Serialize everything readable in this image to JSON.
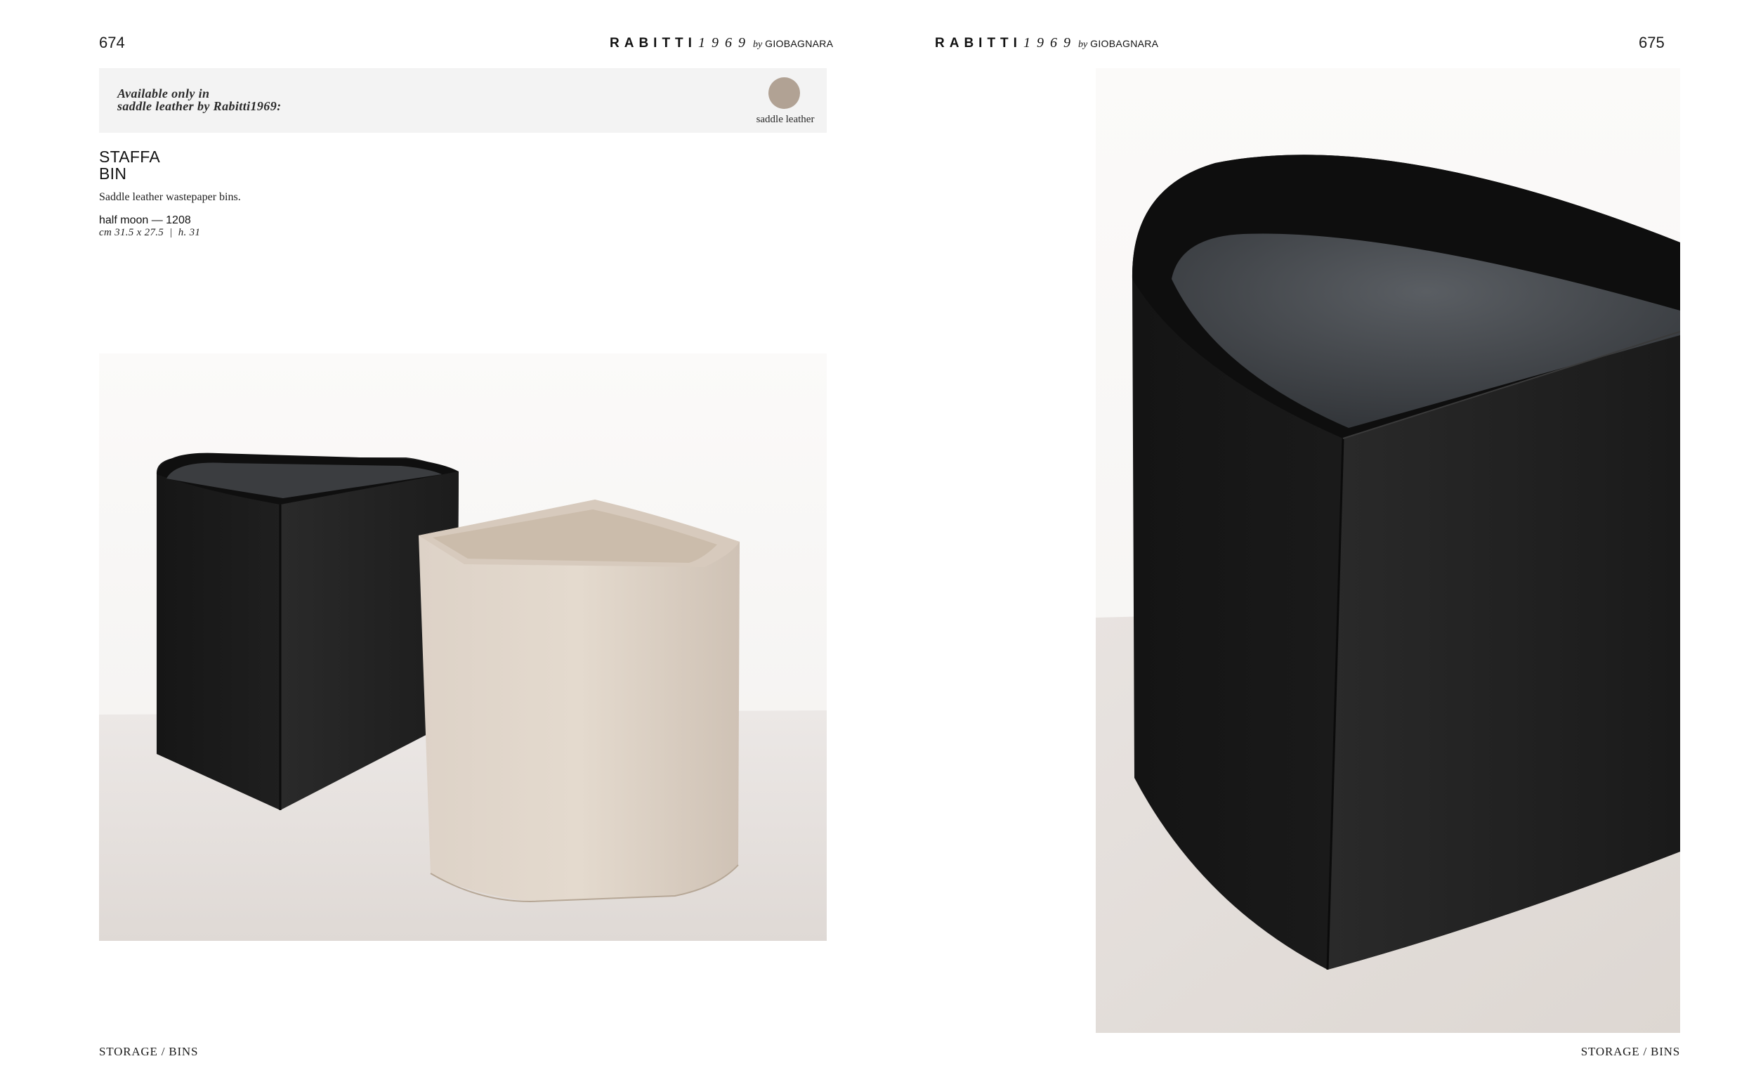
{
  "left_page": {
    "page_number": "674",
    "brand": {
      "word": "RABITTI",
      "year": "1969",
      "by": "by",
      "maker": "GIOBAGNARA"
    },
    "availability": {
      "line1": "Available only in",
      "line2": "saddle leather by Rabitti1969:",
      "swatch_label": "saddle leather",
      "swatch_color": "#b1a294"
    },
    "product": {
      "name_line1": "STAFFA",
      "name_line2": "BIN",
      "description": "Saddle leather wastepaper bins.",
      "variant": "half moon — 1208",
      "dimensions": "cm 31.5 x 27.5  |  h. 31"
    },
    "footer": "STORAGE / BINS"
  },
  "right_page": {
    "page_number": "675",
    "brand": {
      "word": "RABITTI",
      "year": "1969",
      "by": "by",
      "maker": "GIOBAGNARA"
    },
    "footer": "STORAGE / BINS"
  },
  "colors": {
    "black_leather": "#1b1b1b",
    "beige_leather": "#dccfc2",
    "floor": "#e6e1de"
  }
}
